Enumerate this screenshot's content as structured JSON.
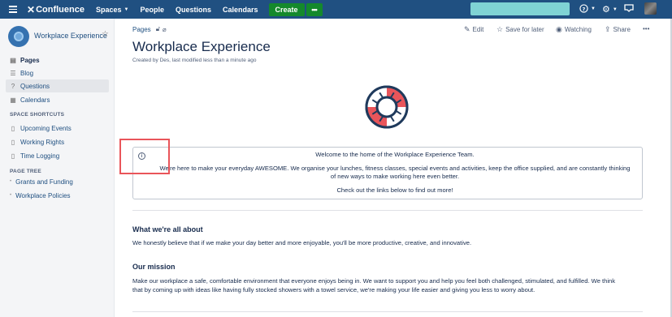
{
  "topnav": {
    "brand": "Confluence",
    "items": [
      {
        "label": "Spaces",
        "has_caret": true
      },
      {
        "label": "People",
        "has_caret": false
      },
      {
        "label": "Questions",
        "has_caret": false
      },
      {
        "label": "Calendars",
        "has_caret": false
      }
    ],
    "create_label": "Create",
    "more_label": "•••",
    "icons": [
      "help-icon",
      "settings-icon",
      "notifications-icon"
    ],
    "bar_color": "#205081",
    "create_color": "#14892c",
    "search_color": "#7fd3d4"
  },
  "sidebar": {
    "space_name": "Workplace Experience",
    "main_items": [
      {
        "label": "Pages",
        "icon": "pages-icon",
        "active": false,
        "bold": true
      },
      {
        "label": "Blog",
        "icon": "blog-icon",
        "active": false,
        "bold": false
      },
      {
        "label": "Questions",
        "icon": "questions-icon",
        "active": true,
        "bold": false
      },
      {
        "label": "Calendars",
        "icon": "calendar-icon",
        "active": false,
        "bold": false
      }
    ],
    "shortcuts_heading": "SPACE SHORTCUTS",
    "shortcuts": [
      "Upcoming Events",
      "Working Rights",
      "Time Logging"
    ],
    "tree_heading": "PAGE TREE",
    "tree": [
      "Grants and Funding",
      "Workplace Policies"
    ]
  },
  "page": {
    "breadcrumb": "Pages",
    "actions": {
      "edit": "Edit",
      "save": "Save for later",
      "watch": "Watching",
      "share": "Share",
      "more": "•••"
    },
    "title": "Workplace Experience",
    "byline": "Created by Des, last modified less than a minute ago",
    "info_panel": {
      "line1": "Welcome to the home of the Workplace Experience Team.",
      "line2": "We're here to make your everyday AWESOME. We organise your lunches, fitness classes, special events and activities, keep the office supplied, and are constantly thinking",
      "line3": "of new ways to make working here even better.",
      "line4": "Check out the links below to find out more!"
    },
    "section1": {
      "heading": "What we're all about",
      "text": "We honestly believe that if we make your day better and more enjoyable, you'll be more productive, creative, and innovative."
    },
    "section2": {
      "heading": "Our mission",
      "text1": "Make our workplace a safe, comfortable environment that everyone enjoys being in. We want to support you and help you feel both challenged, stimulated, and fulfilled. We think",
      "text2": "that by coming up with ideas like having fully stocked showers with a towel service, we're making your life easier and giving you less to worry about."
    },
    "highlight_color": "#e9555a"
  }
}
